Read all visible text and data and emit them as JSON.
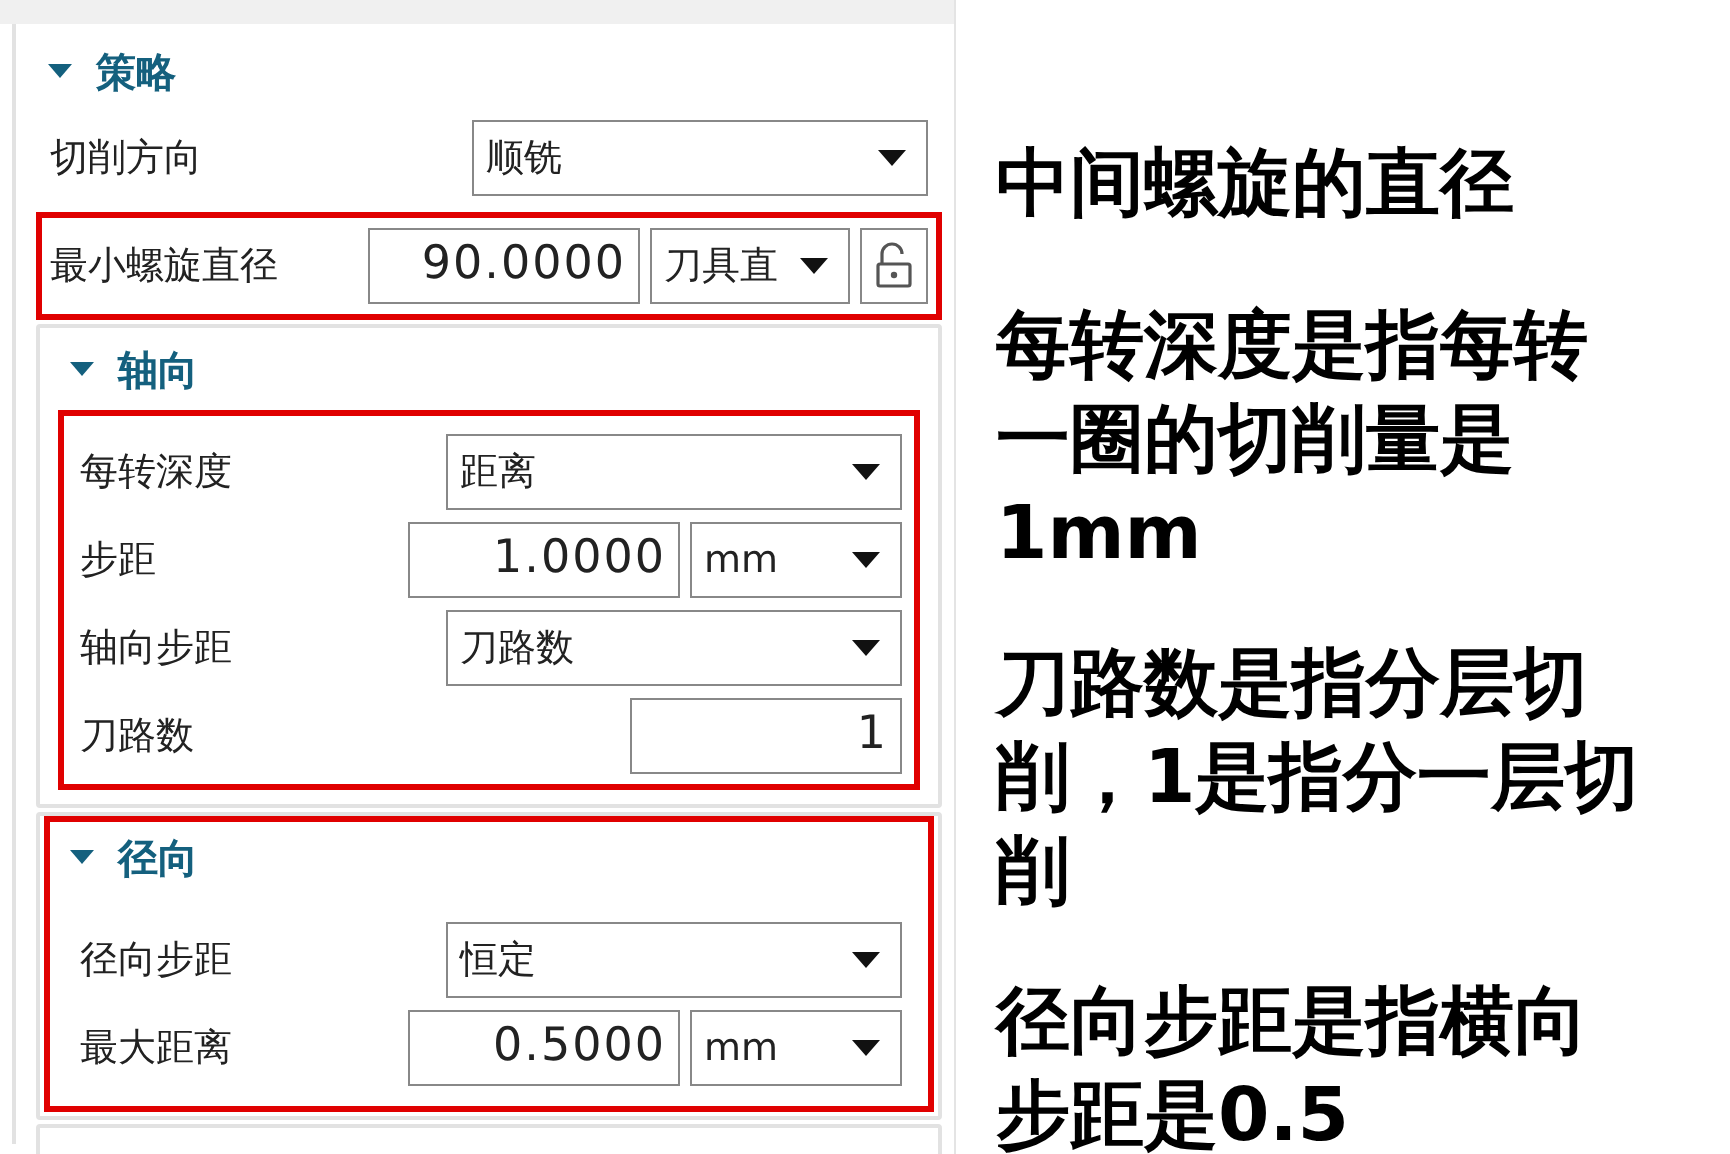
{
  "strategy": {
    "title": "策略",
    "expanded": true,
    "rows": [
      {
        "kind": "select",
        "label": "切削方向",
        "value": "顺铣",
        "highlighted": false
      },
      {
        "kind": "number_unit_lock",
        "label": "最小螺旋直径",
        "value": "90.0000",
        "unit": "刀具直",
        "highlighted": true
      }
    ],
    "groups": [
      {
        "title": "轴向",
        "expanded": true,
        "highlighted": false,
        "rows_highlighted": true,
        "rows": [
          {
            "kind": "select",
            "label": "每转深度",
            "value": "距离"
          },
          {
            "kind": "number_unit",
            "label": "步距",
            "value": "1.0000",
            "unit": "mm"
          },
          {
            "kind": "select",
            "label": "轴向步距",
            "value": "刀路数"
          },
          {
            "kind": "number",
            "label": "刀路数",
            "value": "1"
          }
        ]
      },
      {
        "title": "径向",
        "expanded": true,
        "highlighted": true,
        "rows_highlighted": false,
        "rows": [
          {
            "kind": "select",
            "label": "径向步距",
            "value": "恒定"
          },
          {
            "kind": "number_unit",
            "label": "最大距离",
            "value": "0.5000",
            "unit": "mm"
          }
        ]
      }
    ]
  },
  "notes": [
    "中间螺旋的直径",
    "每转深度是指每转一圈的切削量是1mm",
    "刀路数是指分层切削，1是指分一层切削",
    "径向步距是指横向步距是0.5"
  ]
}
